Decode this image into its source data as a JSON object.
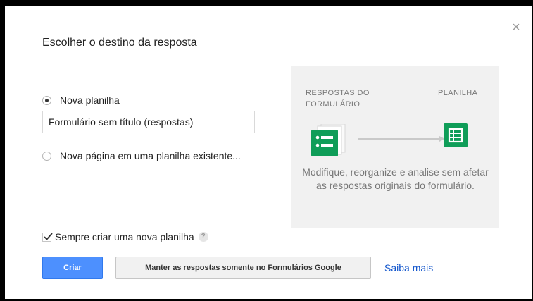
{
  "dialog": {
    "title": "Escolher o destino da resposta",
    "close_label": "×"
  },
  "options": {
    "new_sheet_label": "Nova planilha",
    "new_sheet_selected": true,
    "sheet_name_value": "Formulário sem título (respostas)",
    "existing_sheet_label": "Nova página em uma planilha existente...",
    "existing_sheet_selected": false
  },
  "info_panel": {
    "left_label": "RESPOSTAS DO FORMULÁRIO",
    "right_label": "PLANILHA",
    "description": "Modifique, reorganize e analise sem afetar as respostas originais do formulário.",
    "icons": [
      "form-responses-icon",
      "spreadsheet-icon"
    ]
  },
  "always_create": {
    "label": "Sempre criar uma nova planilha",
    "checked": true,
    "help_glyph": "?"
  },
  "actions": {
    "create_label": "Criar",
    "keep_label": "Manter as respostas somente no Formulários Google",
    "learn_more_label": "Saiba mais"
  },
  "colors": {
    "primary_button": "#4d90fe",
    "link": "#1155cc",
    "sheets_green": "#0f9d58",
    "panel_bg": "#f1f1f1"
  }
}
